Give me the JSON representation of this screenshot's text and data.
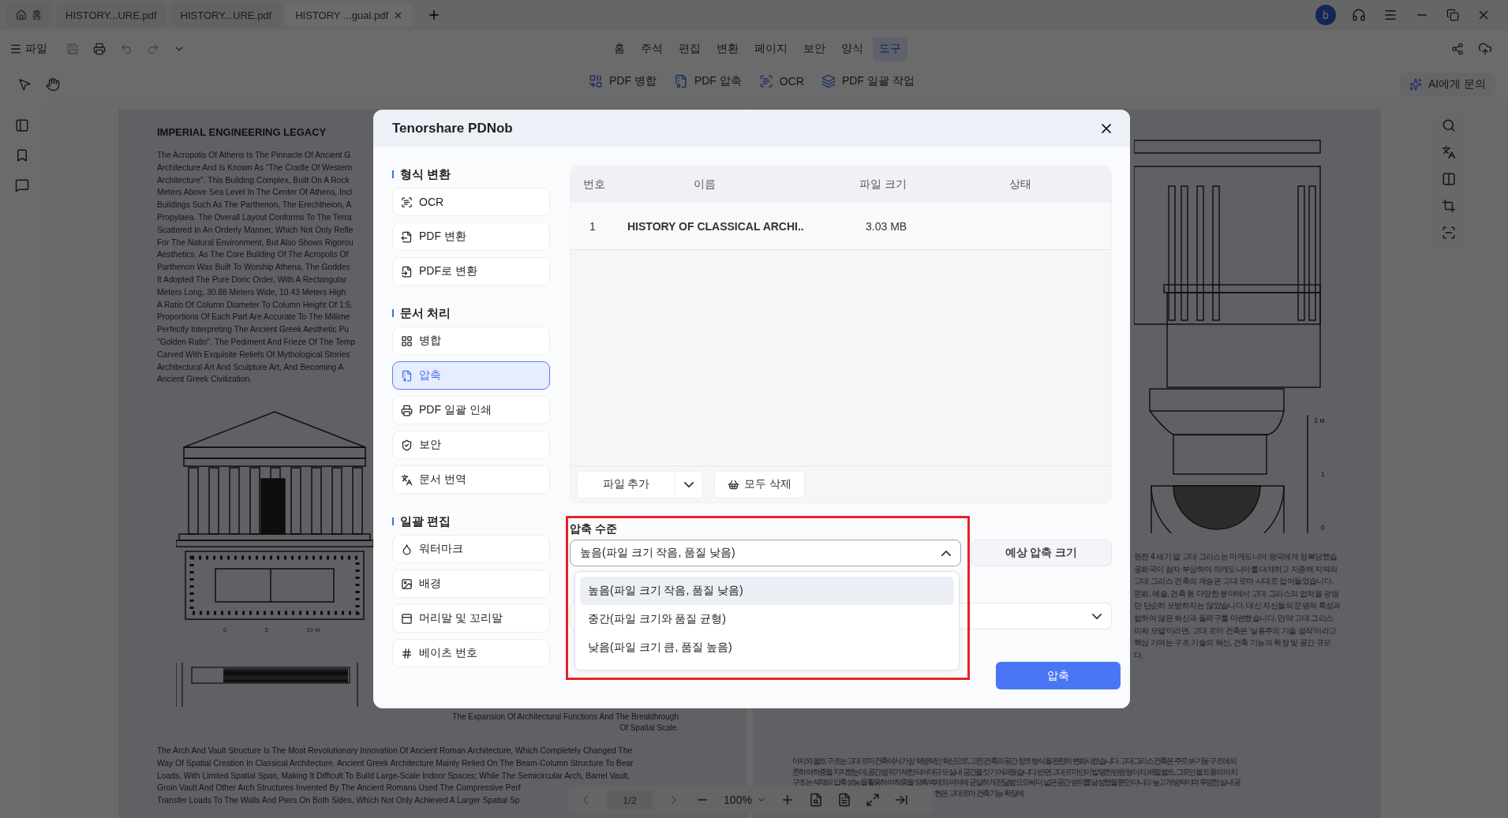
{
  "app_tabs": [
    {
      "label": "홈",
      "kind": "home",
      "selected": false
    },
    {
      "label": "HISTORY...URE.pdf",
      "kind": "file",
      "selected": false
    },
    {
      "label": "HISTORY...URE.pdf",
      "kind": "file",
      "selected": false
    },
    {
      "label": "HISTORY ...gual.pdf",
      "kind": "file",
      "selected": true
    }
  ],
  "user_avatar": "b",
  "file_menu": "파일",
  "menu": [
    {
      "label": "홈",
      "selected": false
    },
    {
      "label": "주석",
      "selected": false
    },
    {
      "label": "편집",
      "selected": false
    },
    {
      "label": "변환",
      "selected": false
    },
    {
      "label": "페이지",
      "selected": false
    },
    {
      "label": "보안",
      "selected": false
    },
    {
      "label": "양식",
      "selected": false
    },
    {
      "label": "도구",
      "selected": true
    }
  ],
  "tools": [
    "PDF 병합",
    "PDF 압축",
    "OCR",
    "PDF 일괄 작업"
  ],
  "ai_button": "AI에게 문의",
  "left_page": {
    "title": "IMPERIAL ENGINEERING LEGACY",
    "paragraph_lines": [
      "The Acropolis Of Athens Is The Pinnacle Of Ancient G",
      "Architecture And Is Known As \"The Cradle Of Western",
      "Architecture\". This Building Complex, Built On A Rock",
      "Meters Above Sea Level In The Center Of Athens, Incl",
      "Buildings Such As The Parthenon, The Erechtheion, A",
      "Propylaea. The Overall Layout Conforms To The Terra",
      "Scattered In An Orderly Manner, Which Not Only Refle",
      "For The Natural Environment, But Also Shows Rigorou",
      "Aesthetics. As The Core Building Of The Acropolis Of",
      "Parthenon Was Built To Worship Athena, The Goddes",
      "It Adopted The Pure Doric Order, With A Rectangular",
      "Meters Long, 30.88 Meters Wide, 10.43 Meters High",
      "A Ratio Of Column Diameter To Column Height Of 1:5.",
      "Proportions Of Each Part Are Accurate To The Millime",
      "Perfectly Interpreting The Ancient Greek Aesthetic Pu",
      "\"Golden Ratio\". The Pediment And Frieze Of The Temp",
      "Carved With Exquisite Reliefs Of Mythological Stories",
      "Architectural Art And Sculpture Art, And Becoming A",
      "Ancient Greek Civilization."
    ],
    "scale_labels": [
      "0",
      "5",
      "10 m"
    ],
    "caption_lines": [
      "The Expansion Of Architectural Functions And The Breakthrough",
      "Of Spatial Scale."
    ],
    "bottom_lines": [
      "The Arch And Vault Structure Is The Most Revolutionary Innovation Of Ancient Roman Architecture, Which Completely Changed The",
      "Way Of Spatial Creation In Classical Architecture. Ancient Greek Architecture Mainly Relied On The Beam-Column Structure To Bear",
      "Loads, With Limited Spatial Span, Making It Difficult To Build Large-Scale Indoor Spaces; While The Semicircular Arch, Barrel Vault,",
      "Groin Vault And Other Arch Structures Invented By The Ancient Romans Used The Compressive Perf",
      "Transfer Loads To The Walls And Piers On Both Sides, Which Not Only Achieved A Larger Spatial Sp"
    ]
  },
  "right_page": {
    "scale_labels": [
      "2 м",
      "1",
      "0"
    ],
    "upper_lines": [
      "원전 4 세기 말 고대 그리스는 마케도니아 왕국에게 정복당했습",
      "공화국이 점차 부상하여 마케도니아를 대체하고 지중해 지역의",
      "고대 그리스 건축의 계승은 고대 로마 시대로 접어들었습니다.",
      "문화, 예술, 건축 등 다양한 분야에서 고대 그리스의 업적을 광범",
      "만 단순히 모방하지는 않았습니다. 대신 자신들의 문명적 특성과",
      "합하여 많은 혁신과 돌파구를 마련했습니다. 만약 고대 그리스",
      "미학 모델'이라면, 고대 로마 건축은 '실용주의 기술 걸작'이라고",
      "핵심 기여는 구조 기술의 혁신, 건축 기능의 확장 및 공간 규모",
      "다."
    ],
    "bottom_lines": [
      "아치와 볼트 구조는 고대 로마 건축에서 가장 혁명적인 혁신으로, 고전 건축의 공간 창조 방식을 완전히 변화시켰습니다. 고대 그리스 건축은 주로 보-기둥 구조에 의",
      "존하여 하중을 지지했는데, 공간 범위가 제한되어 대규모 실내 공간을 짓기 어려웠습니다. 반면 고대 로마인이 발명한 반원형 아치, 배럴 볼트, 그로인 볼트 등의 아치",
      "구조는 석재의 압축 성능을 활용하여 하중을 양측 벽체와 피어에 균일하게 전달함으로써 더 넓은 공간 범위를 달성했을 뿐만 아니라 높고 개방적이며 투명한 실내 공",
      "현은 고대 로마 건축 기능 확장에"
    ]
  },
  "page_toolbar": {
    "page": "1/2",
    "zoom": "100%"
  },
  "dialog": {
    "title": "Tenorshare PDNob",
    "nav_sections": [
      {
        "label": "형식 변환",
        "items": [
          {
            "label": "OCR",
            "selected": false
          },
          {
            "label": "PDF 변환",
            "selected": false
          },
          {
            "label": "PDF로 변환",
            "selected": false
          }
        ]
      },
      {
        "label": "문서 처리",
        "items": [
          {
            "label": "병합",
            "selected": false
          },
          {
            "label": "압축",
            "selected": true
          },
          {
            "label": "PDF 일괄 인쇄",
            "selected": false
          },
          {
            "label": "보안",
            "selected": false
          },
          {
            "label": "문서 번역",
            "selected": false
          }
        ]
      },
      {
        "label": "일괄 편집",
        "items": [
          {
            "label": "워터마크",
            "selected": false
          },
          {
            "label": "배경",
            "selected": false
          },
          {
            "label": "머리말 및 꼬리말",
            "selected": false
          },
          {
            "label": "베이츠 번호",
            "selected": false
          }
        ]
      }
    ],
    "table": {
      "columns": [
        "번호",
        "이름",
        "파일 크기",
        "상태"
      ],
      "rows": [
        {
          "number": "1",
          "name": "HISTORY OF CLASSICAL ARCHI..",
          "size": "3.03 MB"
        }
      ]
    },
    "add_file_button": "파일 추가",
    "delete_all_button": "모두 삭제",
    "compression": {
      "label": "압축 수준",
      "value": "높음(파일 크기 작음, 품질 낮음)",
      "expanded": true,
      "options": [
        {
          "label": "높음(파일 크기 작음, 품질 낮음)",
          "selected": true
        },
        {
          "label": "중간(파일 크기와 품질 균형)",
          "selected": false
        },
        {
          "label": "낮음(파일 크기 큼, 품질 높음)",
          "selected": false
        }
      ]
    },
    "estimate_button": "예상 압축 크기",
    "compress_button": "압축"
  }
}
